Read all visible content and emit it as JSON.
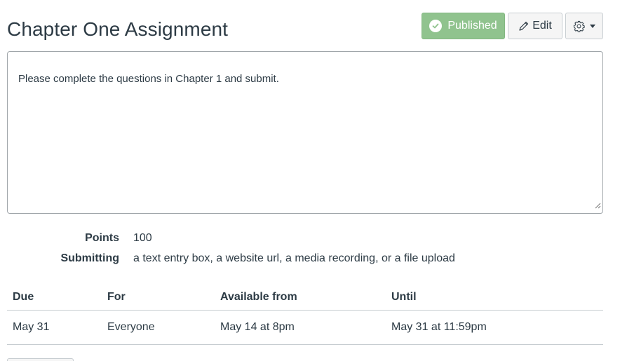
{
  "header": {
    "title": "Chapter One Assignment",
    "published_label": "Published",
    "edit_label": "Edit"
  },
  "description": {
    "text": "Please complete the questions in Chapter 1 and submit."
  },
  "details": {
    "points_label": "Points",
    "points_value": "100",
    "submitting_label": "Submitting",
    "submitting_value": "a text entry box, a website url, a media recording, or a file upload"
  },
  "dates": {
    "headers": [
      "Due",
      "For",
      "Available from",
      "Until"
    ],
    "rows": [
      [
        "May 31",
        "Everyone",
        "May 14 at 8pm",
        "May 31 at 11:59pm"
      ]
    ]
  },
  "icons": {
    "published": "check-circle-icon",
    "edit": "pencil-icon",
    "settings": "gear-icon",
    "menu": "caret-down-icon"
  },
  "colors": {
    "published_bg": "#90c38e",
    "text": "#2d3b45",
    "border": "#c7cdd1"
  }
}
